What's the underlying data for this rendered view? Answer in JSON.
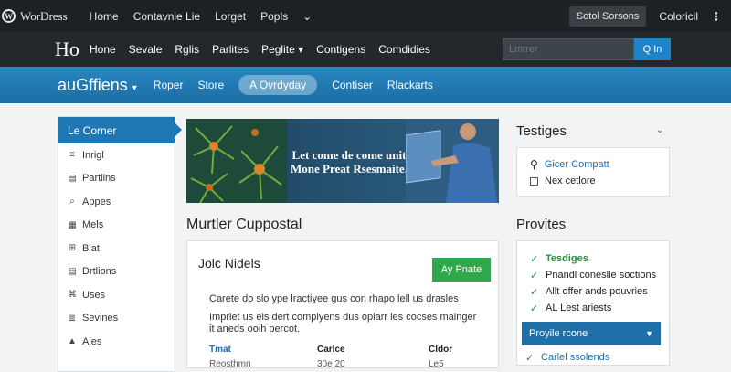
{
  "topbar": {
    "logo_glyph": "W",
    "logo_text": "WorDress",
    "nav": [
      "Home",
      "Contavnie Lie",
      "Lorget",
      "Popls"
    ],
    "box_label": "Sotol Sorsons",
    "right_label": "Coloricil"
  },
  "header": {
    "brand": "Ho",
    "nav": [
      "Hone",
      "Sevale",
      "Rglis",
      "Parlites",
      "Peglite",
      "Contigens",
      "Comdidies"
    ],
    "search_placeholder": "Lmtrer",
    "search_button": "Q In"
  },
  "bluebar": {
    "site_name": "auGffiens",
    "nav": [
      "Roper",
      "Store",
      "A Ovrdyday",
      "Contiser",
      "Rlackarts"
    ],
    "active_index": 2
  },
  "sidebar": {
    "active": "Le Corner",
    "items": [
      {
        "icon": "list-icon",
        "glyph": "≡",
        "label": "Inrigl"
      },
      {
        "icon": "document-icon",
        "glyph": "▤",
        "label": "Partlins"
      },
      {
        "icon": "search-icon",
        "glyph": "⌕",
        "label": "Appes"
      },
      {
        "icon": "grid-icon",
        "glyph": "▦",
        "label": "Mels"
      },
      {
        "icon": "gear-icon",
        "glyph": "⊞",
        "label": "Blat"
      },
      {
        "icon": "document-icon",
        "glyph": "▤",
        "label": "Drtlions"
      },
      {
        "icon": "location-icon",
        "glyph": "⌘",
        "label": "Uses"
      },
      {
        "icon": "menu-icon",
        "glyph": "≣",
        "label": "Sevines"
      },
      {
        "icon": "chart-icon",
        "glyph": "▲",
        "label": "Aies"
      }
    ]
  },
  "banner": {
    "line1": "Let come de come unit",
    "line2": "Mone Preat Rsesmaite."
  },
  "main": {
    "section_title": "Murtler Cuppostal",
    "card": {
      "title": "Jolc Nidels",
      "button": "Ay Pnate",
      "para1": "Carete do slo ype lractiyee gus con rhapo lell us drasles",
      "para2": "Impriet us eis dert complyens dus oplarr les cocses mainger it aneds ooih percot.",
      "headers": [
        "Tmat",
        "Carlce",
        "Cldor"
      ],
      "row": [
        "Reosthmn",
        "30e 20",
        "Le5"
      ]
    }
  },
  "right": {
    "title1": "Testiges",
    "links": [
      {
        "icon": "search-icon",
        "label": "Gicer Compatt"
      },
      {
        "icon": "checkbox-icon",
        "label": "Nex cetlore"
      }
    ],
    "title2": "Provites",
    "checks": [
      "Tesdiges",
      "Pnandl coneslle soctions",
      "Allt offer ands pouvries",
      "AL Lest ariests"
    ],
    "dropdown": "Proyile rcone",
    "bottom": "Carlel ssolends"
  },
  "colors": {
    "accent": "#1f78b4",
    "success": "#2ea84a",
    "topbar": "#1e2124"
  }
}
